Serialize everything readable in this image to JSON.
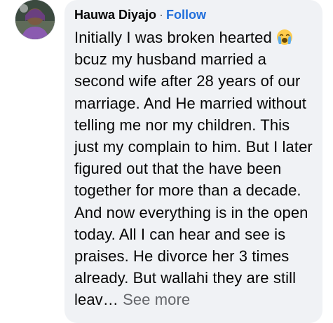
{
  "comment": {
    "author": "Hauwa Diyajo",
    "separator": "·",
    "follow_label": "Follow",
    "emoji_name": "loudly-crying-face",
    "text_part1": "Initially I was broken hearted ",
    "text_part2": "bcuz my husband married a second wife after 28 years of our marriage. And He married without telling me nor my children. This just my complain to him. But I later figured out that the have been together for more than a decade. And now everything is in the open today. All I can hear and see is praises. He divorce her 3 times already. But wallahi they are still leav…",
    "see_more_label": "See more"
  },
  "avatar": {
    "icon": "profile-photo"
  },
  "colors": {
    "bubble": "#f0f2f5",
    "name": "#050505",
    "follow": "#216fdb",
    "secondary": "#65676b"
  }
}
